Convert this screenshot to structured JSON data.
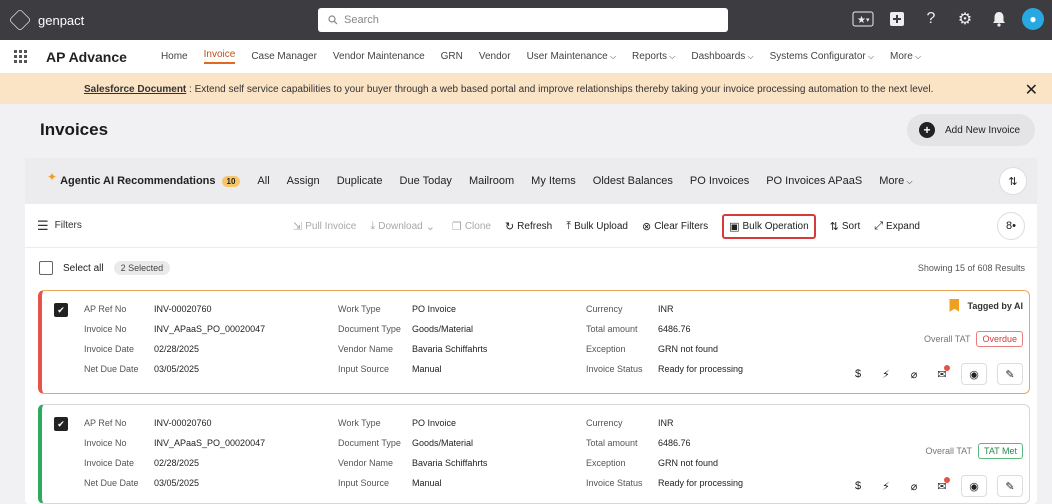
{
  "topbar": {
    "brand": "genpact",
    "search_placeholder": "Search"
  },
  "nav": {
    "app_name": "AP Advance",
    "links": [
      {
        "label": "Home"
      },
      {
        "label": "Invoice"
      },
      {
        "label": "Case Manager"
      },
      {
        "label": "Vendor Maintenance"
      },
      {
        "label": "GRN"
      },
      {
        "label": "Vendor"
      },
      {
        "label": "User Maintenance"
      },
      {
        "label": "Reports"
      },
      {
        "label": "Dashboards"
      },
      {
        "label": "Systems Configurator"
      },
      {
        "label": "More"
      }
    ]
  },
  "banner": {
    "link": "Salesforce Document",
    "text": " : Extend self service capabilities to your buyer through a web based portal and improve relationships thereby taking your invoice processing automation to the next level."
  },
  "page": {
    "title": "Invoices",
    "add_button": "Add New Invoice"
  },
  "tabs": {
    "agentic": "Agentic AI Recommendations",
    "agentic_count": "10",
    "items": [
      "All",
      "Assign",
      "Duplicate",
      "Due Today",
      "Mailroom",
      "My Items",
      "Oldest Balances",
      "PO Invoices",
      "PO Invoices APaaS",
      "More"
    ]
  },
  "toolbar": {
    "filters": "Filters",
    "pull_invoice": "Pull Invoice",
    "download": "Download",
    "clone": "Clone",
    "refresh": "Refresh",
    "bulk_upload": "Bulk Upload",
    "clear_filters": "Clear Filters",
    "bulk_operation": "Bulk Operation",
    "sort": "Sort",
    "expand": "Expand",
    "more_count": "8"
  },
  "selection": {
    "select_all": "Select all",
    "selected": "2 Selected",
    "showing": "Showing 15 of 608 Results"
  },
  "labels": {
    "ap_ref": "AP Ref No",
    "invoice_no": "Invoice No",
    "invoice_date": "Invoice Date",
    "net_due": "Net Due Date",
    "work_type": "Work Type",
    "doc_type": "Document Type",
    "vendor_name": "Vendor Name",
    "input_source": "Input Source",
    "currency": "Currency",
    "total_amount": "Total amount",
    "exception": "Exception",
    "invoice_status": "Invoice Status",
    "overall_tat": "Overall TAT",
    "tagged_ai": "Tagged by AI"
  },
  "invoices": [
    {
      "ap_ref": "INV-00020760",
      "invoice_no": "INV_APaaS_PO_00020047",
      "invoice_date": "02/28/2025",
      "net_due": "03/05/2025",
      "work_type": "PO Invoice",
      "doc_type": "Goods/Material",
      "vendor_name": "Bavaria Schiffahrts",
      "input_source": "Manual",
      "currency": "INR",
      "total_amount": "6486.76",
      "exception": "GRN not found",
      "invoice_status": "Ready for processing",
      "tat": "Overdue"
    },
    {
      "ap_ref": "INV-00020760",
      "invoice_no": "INV_APaaS_PO_00020047",
      "invoice_date": "02/28/2025",
      "net_due": "03/05/2025",
      "work_type": "PO Invoice",
      "doc_type": "Goods/Material",
      "vendor_name": "Bavaria Schiffahrts",
      "input_source": "Manual",
      "currency": "INR",
      "total_amount": "6486.76",
      "exception": "GRN not found",
      "invoice_status": "Ready for processing",
      "tat": "TAT Met"
    }
  ]
}
